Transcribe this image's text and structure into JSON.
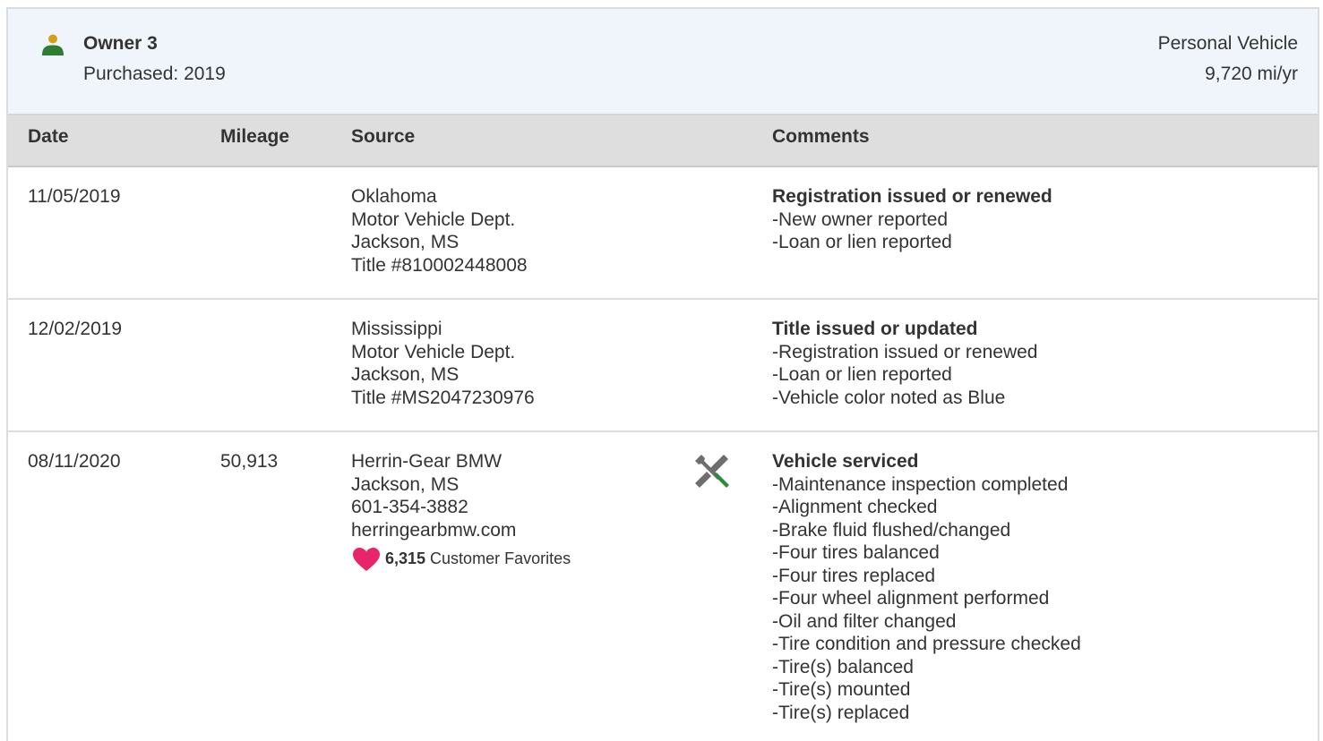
{
  "owner": {
    "name": "Owner 3",
    "purchased": "Purchased: 2019",
    "vehicle_type": "Personal Vehicle",
    "miles_per_year": "9,720 mi/yr",
    "icon": "person-icon",
    "icon_colors": {
      "head": "#d4a017",
      "body": "#2e7d32"
    }
  },
  "table": {
    "headers": {
      "date": "Date",
      "mileage": "Mileage",
      "source": "Source",
      "comments": "Comments"
    },
    "rows": [
      {
        "date": "11/05/2019",
        "mileage": "",
        "source": [
          "Oklahoma",
          "Motor Vehicle Dept.",
          "Jackson, MS",
          "Title #810002448008"
        ],
        "comment_title": "Registration issued or renewed",
        "comment_items": [
          "New owner reported",
          "Loan or lien reported"
        ]
      },
      {
        "date": "12/02/2019",
        "mileage": "",
        "source": [
          "Mississippi",
          "Motor Vehicle Dept.",
          "Jackson, MS",
          "Title #MS2047230976"
        ],
        "comment_title": "Title issued or updated",
        "comment_items": [
          "Registration issued or renewed",
          "Loan or lien reported",
          "Vehicle color noted as Blue"
        ]
      },
      {
        "date": "08/11/2020",
        "mileage": "50,913",
        "source": [
          "Herrin-Gear BMW",
          "Jackson, MS",
          "601-354-3882",
          "herringearbmw.com"
        ],
        "favorites_count": "6,315",
        "favorites_label": "Customer Favorites",
        "service_icon": "wrench-screwdriver-icon",
        "comment_title": "Vehicle serviced",
        "comment_items": [
          "Maintenance inspection completed",
          "Alignment checked",
          "Brake fluid flushed/changed",
          "Four tires balanced",
          "Four tires replaced",
          "Four wheel alignment performed",
          "Oil and filter changed",
          "Tire condition and pressure checked",
          "Tire(s) balanced",
          "Tire(s) mounted",
          "Tire(s) replaced"
        ]
      }
    ]
  },
  "colors": {
    "heart": "#e8246a",
    "service_green": "#2e8b3a",
    "service_gray": "#6e6e6e"
  }
}
